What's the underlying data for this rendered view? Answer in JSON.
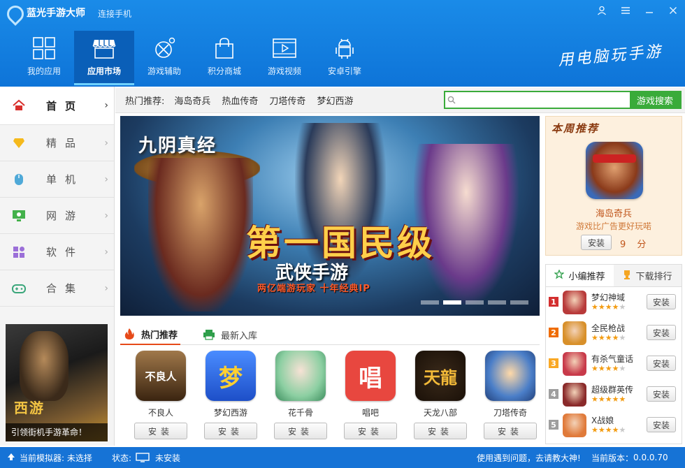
{
  "app": {
    "title": "蓝光手游大师",
    "connect_label": "连接手机",
    "slogan": "用电脑玩手游"
  },
  "window_controls": [
    "user-icon",
    "menu-icon",
    "minimize-icon",
    "close-icon"
  ],
  "nav": [
    {
      "label": "我的应用",
      "icon": "grid-icon"
    },
    {
      "label": "应用市场",
      "icon": "store-icon",
      "active": true
    },
    {
      "label": "游戏辅助",
      "icon": "tools-icon"
    },
    {
      "label": "积分商城",
      "icon": "bag-icon"
    },
    {
      "label": "游戏视频",
      "icon": "video-icon"
    },
    {
      "label": "安卓引擎",
      "icon": "android-icon"
    }
  ],
  "sidebar": {
    "items": [
      {
        "label": "首页",
        "icon": "home-icon",
        "active": true
      },
      {
        "label": "精品",
        "icon": "diamond-icon"
      },
      {
        "label": "单机",
        "icon": "mouse-icon"
      },
      {
        "label": "网游",
        "icon": "monitor-icon"
      },
      {
        "label": "软件",
        "icon": "apps-icon"
      },
      {
        "label": "合集",
        "icon": "gamepad-icon"
      }
    ],
    "banner": {
      "caption": "引领街机手游革命！",
      "logo_text": "西游"
    }
  },
  "hot": {
    "label": "热门推荐:",
    "links": [
      "海岛奇兵",
      "热血传奇",
      "刀塔传奇",
      "梦幻西游"
    ]
  },
  "search": {
    "placeholder": "",
    "button_label": "游戏搜索"
  },
  "banner": {
    "brand": "九阴真经",
    "headline": "第一国民级",
    "sub1": "武侠手游",
    "sub2": "两亿端游玩家  十年经典IP",
    "slides": 5,
    "active_slide": 2
  },
  "tabs": [
    {
      "label": "热门推荐",
      "icon": "flame-icon",
      "active": true
    },
    {
      "label": "最新入库",
      "icon": "printer-icon"
    }
  ],
  "apps": [
    {
      "name": "不良人",
      "glyph": "不良人",
      "color": "#8a5a2a",
      "install_label": "安装"
    },
    {
      "name": "梦幻西游",
      "glyph": "梦",
      "color": "#2f6fe8",
      "install_label": "安装"
    },
    {
      "name": "花千骨",
      "glyph": "",
      "color": "#5ab878",
      "install_label": "安装"
    },
    {
      "name": "唱吧",
      "glyph": "唱",
      "color": "#e8473f",
      "install_label": "安装"
    },
    {
      "name": "天龙八部",
      "glyph": "天龍",
      "color": "#d8a63a",
      "install_label": "安装"
    },
    {
      "name": "刀塔传奇",
      "glyph": "",
      "color": "#4a7ec8",
      "install_label": "安装"
    }
  ],
  "weekly": {
    "title": "本周推荐",
    "name": "海岛奇兵",
    "desc": "游戏比广告更好玩喏",
    "install_label": "安装",
    "score": "9 分"
  },
  "rank": {
    "tabs": [
      {
        "label": "小编推荐",
        "icon": "star-outline-icon",
        "active": true
      },
      {
        "label": "下载排行",
        "icon": "trophy-icon"
      }
    ],
    "items": [
      {
        "num": "1",
        "name": "梦幻神域",
        "stars": 4,
        "num_color": "#d32f2f",
        "icon_color": "#b83a3a",
        "install_label": "安装"
      },
      {
        "num": "2",
        "name": "全民枪战",
        "stars": 4,
        "num_color": "#ef6c00",
        "icon_color": "#d8902a",
        "install_label": "安装"
      },
      {
        "num": "3",
        "name": "有杀气童话",
        "stars": 4,
        "num_color": "#f9a825",
        "icon_color": "#c83a4a",
        "install_label": "安装"
      },
      {
        "num": "4",
        "name": "超级群英传",
        "stars": 5,
        "num_color": "#9e9e9e",
        "icon_color": "#8a2a2a",
        "install_label": "安装"
      },
      {
        "num": "5",
        "name": "X战娘",
        "stars": 4,
        "num_color": "#9e9e9e",
        "icon_color": "#e07a3a",
        "install_label": "安装"
      }
    ]
  },
  "status": {
    "emulator": "当前模拟器: 未选择",
    "state_label": "状态:",
    "state_value": "未安装",
    "help": "使用遇到问题，去请教大神!",
    "version_label": "当前版本：",
    "version_value": "0.0.0.70"
  },
  "colors": {
    "header_blue": "#0e74d8",
    "accent_green": "#3aab3a",
    "tab_accent": "#e64a19"
  }
}
